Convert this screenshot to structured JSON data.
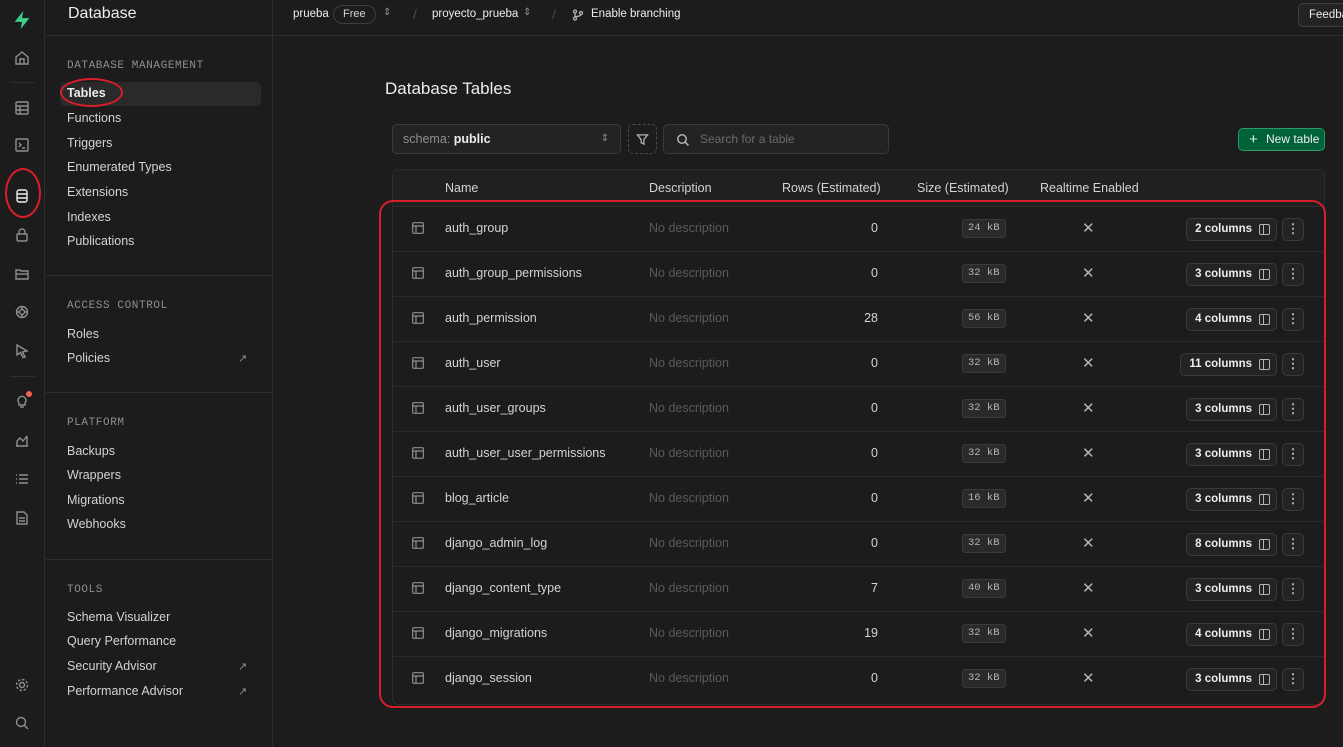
{
  "sidebar": {
    "title": "Database",
    "sections": [
      {
        "title": "DATABASE MANAGEMENT",
        "items": [
          "Tables",
          "Functions",
          "Triggers",
          "Enumerated Types",
          "Extensions",
          "Indexes",
          "Publications"
        ]
      },
      {
        "title": "ACCESS CONTROL",
        "items": [
          "Roles",
          "Policies"
        ]
      },
      {
        "title": "PLATFORM",
        "items": [
          "Backups",
          "Wrappers",
          "Migrations",
          "Webhooks"
        ]
      },
      {
        "title": "TOOLS",
        "items": [
          "Schema Visualizer",
          "Query Performance",
          "Security Advisor",
          "Performance Advisor"
        ]
      }
    ],
    "external_arrow": "↗"
  },
  "topbar": {
    "org": "prueba",
    "plan_badge": "Free",
    "project": "proyecto_prueba",
    "branching": "Enable branching",
    "feedback": "Feedback"
  },
  "main": {
    "title": "Database Tables",
    "schema_label": "schema:",
    "schema_value": "public",
    "search_placeholder": "Search for a table",
    "new_table": "New table"
  },
  "table": {
    "headers": {
      "name": "Name",
      "description": "Description",
      "rows": "Rows (Estimated)",
      "size": "Size (Estimated)",
      "realtime": "Realtime Enabled"
    },
    "rows": [
      {
        "name": "auth_group",
        "description": "No description",
        "rows": "0",
        "size": "24 kB",
        "realtime": "✕",
        "columns": "2 columns"
      },
      {
        "name": "auth_group_permissions",
        "description": "No description",
        "rows": "0",
        "size": "32 kB",
        "realtime": "✕",
        "columns": "3 columns"
      },
      {
        "name": "auth_permission",
        "description": "No description",
        "rows": "28",
        "size": "56 kB",
        "realtime": "✕",
        "columns": "4 columns"
      },
      {
        "name": "auth_user",
        "description": "No description",
        "rows": "0",
        "size": "32 kB",
        "realtime": "✕",
        "columns": "11 columns"
      },
      {
        "name": "auth_user_groups",
        "description": "No description",
        "rows": "0",
        "size": "32 kB",
        "realtime": "✕",
        "columns": "3 columns"
      },
      {
        "name": "auth_user_user_permissions",
        "description": "No description",
        "rows": "0",
        "size": "32 kB",
        "realtime": "✕",
        "columns": "3 columns"
      },
      {
        "name": "blog_article",
        "description": "No description",
        "rows": "0",
        "size": "16 kB",
        "realtime": "✕",
        "columns": "3 columns"
      },
      {
        "name": "django_admin_log",
        "description": "No description",
        "rows": "0",
        "size": "32 kB",
        "realtime": "✕",
        "columns": "8 columns"
      },
      {
        "name": "django_content_type",
        "description": "No description",
        "rows": "7",
        "size": "40 kB",
        "realtime": "✕",
        "columns": "3 columns"
      },
      {
        "name": "django_migrations",
        "description": "No description",
        "rows": "19",
        "size": "32 kB",
        "realtime": "✕",
        "columns": "4 columns"
      },
      {
        "name": "django_session",
        "description": "No description",
        "rows": "0",
        "size": "32 kB",
        "realtime": "✕",
        "columns": "3 columns"
      }
    ]
  },
  "colors": {
    "brand": "#3ecf8e",
    "accent_button": "#006239",
    "annotation": "#d91e2b",
    "notification": "#f06548"
  },
  "icons": {
    "rail": [
      "supabase-logo-icon",
      "home-icon",
      "table-editor-icon",
      "sql-editor-icon",
      "database-icon",
      "auth-lock-icon",
      "storage-icon",
      "realtime-icon",
      "edge-functions-icon",
      "advisors-icon",
      "reports-icon",
      "logs-icon",
      "docs-icon",
      "settings-icon",
      "search-icon"
    ]
  }
}
